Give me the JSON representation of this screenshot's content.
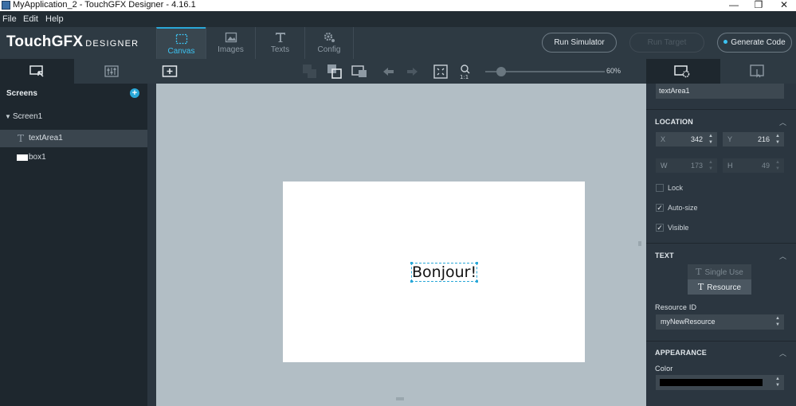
{
  "window": {
    "title": "MyApplication_2 - TouchGFX Designer - 4.16.1",
    "minimize": "—",
    "restore": "❐",
    "close": "✕"
  },
  "menu": [
    "File",
    "Edit",
    "Help"
  ],
  "logo": {
    "part1": "TouchGFX",
    "part2": "DESIGNER"
  },
  "nav_tabs": [
    {
      "label": "Canvas",
      "icon": "canvas-icon",
      "active": true
    },
    {
      "label": "Images",
      "icon": "image-icon",
      "active": false
    },
    {
      "label": "Texts",
      "icon": "text-icon",
      "active": false
    },
    {
      "label": "Config",
      "icon": "gear-icon",
      "active": false
    }
  ],
  "header_buttons": {
    "run_simulator": "Run Simulator",
    "run_target": "Run Target",
    "generate_code": "Generate Code"
  },
  "toolbar": {
    "zoom_label": "60%",
    "zoom_value": 0.1
  },
  "left_panel": {
    "title": "Screens",
    "add": "+",
    "tree": [
      {
        "label": "Screen1",
        "type": "screen"
      },
      {
        "label": "textArea1",
        "type": "text",
        "selected": true
      },
      {
        "label": "box1",
        "type": "box"
      }
    ]
  },
  "canvas": {
    "text": "Bonjour!"
  },
  "properties": {
    "name": "textArea1",
    "location": {
      "title": "LOCATION",
      "x_label": "X",
      "x": "342",
      "y_label": "Y",
      "y": "216",
      "w_label": "W",
      "w": "173",
      "h_label": "H",
      "h": "49"
    },
    "checks": [
      {
        "label": "Lock",
        "checked": false
      },
      {
        "label": "Auto-size",
        "checked": true
      },
      {
        "label": "Visible",
        "checked": true
      }
    ],
    "text_section": {
      "title": "TEXT",
      "single_use": "Single Use",
      "resource": "Resource",
      "resource_id_label": "Resource ID",
      "resource_id": "myNewResource"
    },
    "appearance": {
      "title": "APPEARANCE",
      "color_label": "Color",
      "color": "#000000"
    }
  },
  "colors": {
    "accent": "#2aa8d8",
    "panel_dark": "#1e272e",
    "panel": "#2b3640",
    "canvas_bg": "#b2bec5"
  }
}
